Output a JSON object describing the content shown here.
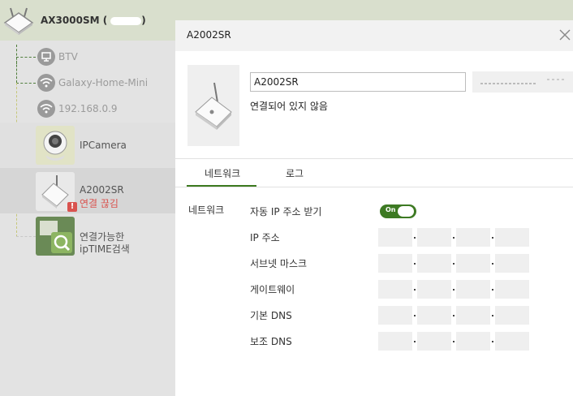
{
  "root": {
    "name": "AX3000SM (",
    "name_suffix": ")"
  },
  "tree": {
    "nodes": [
      {
        "label": "BTV",
        "icon": "monitor-icon"
      },
      {
        "label": "Galaxy-Home-Mini",
        "icon": "wifi-icon"
      },
      {
        "label": "192.168.0.9",
        "icon": "wifi-icon"
      }
    ],
    "ipcamera": {
      "label": "IPCamera"
    },
    "extender": {
      "label": "A2002SR",
      "status": "연결 끊김",
      "status_icon": "!"
    },
    "search": {
      "line1": "연결가능한",
      "line2": "ipTIME검색"
    }
  },
  "panel": {
    "title": "A2002SR",
    "close_icon": "close-icon",
    "device_name": "A2002SR",
    "status": "연결되어 있지 않음",
    "tabs": [
      {
        "label": "네트워크",
        "active": true
      },
      {
        "label": "로그",
        "active": false
      }
    ],
    "network": {
      "section_label": "네트워크",
      "auto_ip_label": "자동 IP 주소 받기",
      "toggle_text": "On",
      "toggle_on": true,
      "fields": [
        {
          "label": "IP 주소"
        },
        {
          "label": "서브넷 마스크"
        },
        {
          "label": "게이트웨이"
        },
        {
          "label": "기본 DNS"
        },
        {
          "label": "보조 DNS"
        }
      ]
    }
  },
  "colors": {
    "accent": "#3d7a23",
    "dashed_green": "#4e7d3a",
    "dashed_yellow": "#c6c77a",
    "error": "#d9534f"
  }
}
